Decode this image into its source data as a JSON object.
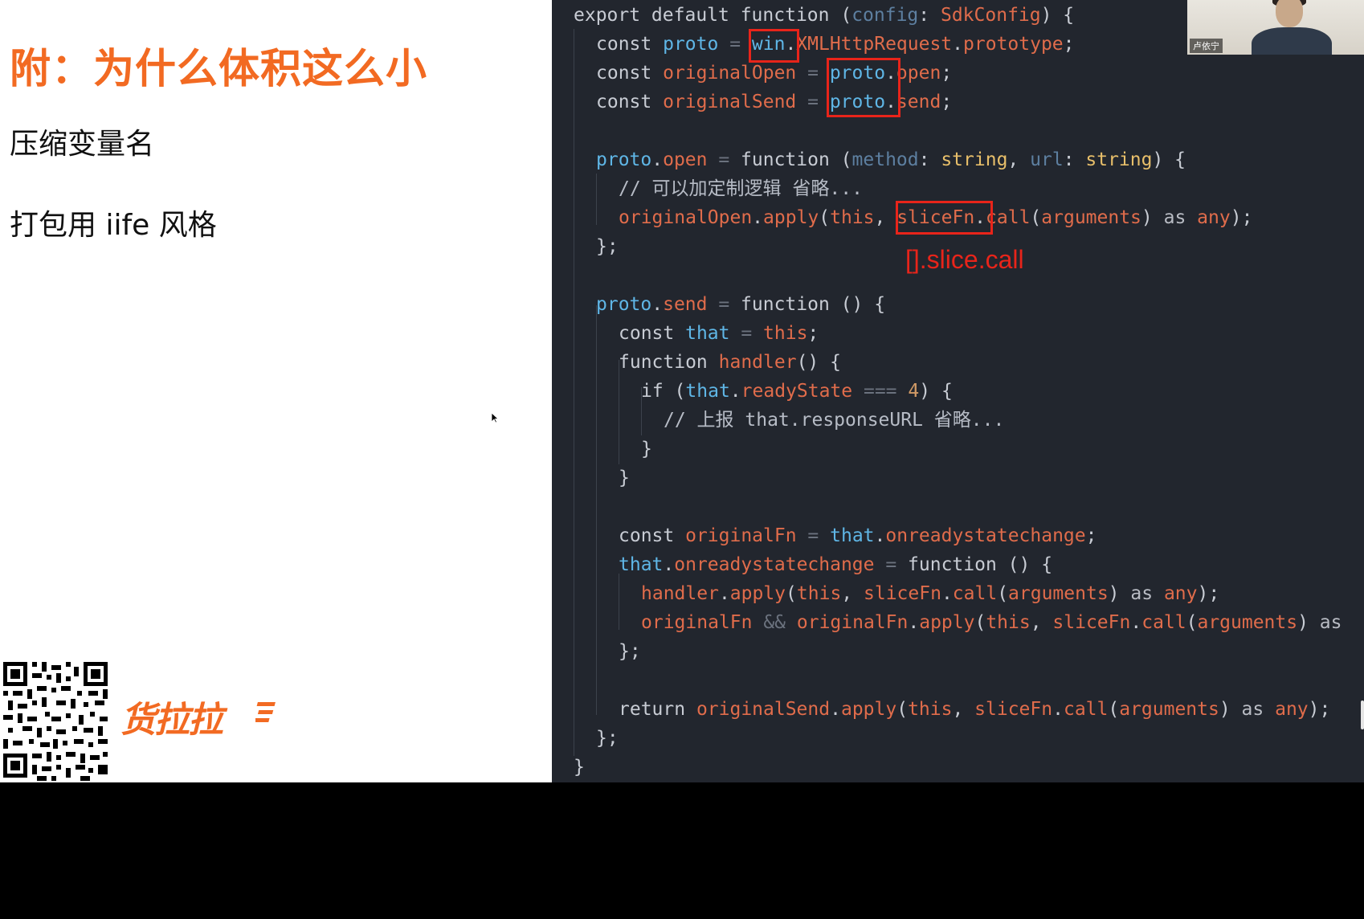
{
  "slide": {
    "title": "附：为什么体积这么小",
    "bullets": [
      "压缩变量名",
      "打包用 iife 风格"
    ],
    "logo_text": "货拉拉"
  },
  "webcam": {
    "name": "卢依宁"
  },
  "annotation": "[].slice.call",
  "code": {
    "l1": [
      "export default function (",
      "config",
      ": ",
      "SdkConfig",
      ") {"
    ],
    "l2": [
      "const ",
      "proto",
      " = ",
      "win",
      ".",
      "XMLHttpRequest",
      ".",
      "prototype",
      ";"
    ],
    "l3": [
      "const ",
      "originalOpen",
      " = ",
      "proto",
      ".",
      "open",
      ";"
    ],
    "l4": [
      "const ",
      "originalSend",
      " = ",
      "proto",
      ".",
      "send",
      ";"
    ],
    "l6": [
      "proto",
      ".",
      "open",
      " = ",
      "function",
      " (",
      "method",
      ": ",
      "string",
      ", ",
      "url",
      ": ",
      "string",
      ") {"
    ],
    "l7": "// 可以加定制逻辑 省略...",
    "l8": [
      "originalOpen",
      ".",
      "apply",
      "(",
      "this",
      ", ",
      "sliceFn",
      ".",
      "call",
      "(",
      "arguments",
      ") ",
      "as",
      " ",
      "any",
      ");"
    ],
    "l9": "};",
    "l11": [
      "proto",
      ".",
      "send",
      " = ",
      "function",
      " () {"
    ],
    "l12": [
      "const ",
      "that",
      " = ",
      "this",
      ";"
    ],
    "l13": [
      "function ",
      "handler",
      "() {"
    ],
    "l14": [
      "if ",
      "(",
      "that",
      ".",
      "readyState",
      " === ",
      "4",
      ") {"
    ],
    "l15": "// 上报 that.responseURL 省略...",
    "l16": "}",
    "l17": "}",
    "l19": [
      "const ",
      "originalFn",
      " = ",
      "that",
      ".",
      "onreadystatechange",
      ";"
    ],
    "l20": [
      "that",
      ".",
      "onreadystatechange",
      " = ",
      "function",
      " () {"
    ],
    "l21": [
      "handler",
      ".",
      "apply",
      "(",
      "this",
      ", ",
      "sliceFn",
      ".",
      "call",
      "(",
      "arguments",
      ") ",
      "as",
      " ",
      "any",
      ");"
    ],
    "l22": [
      "originalFn",
      " && ",
      "originalFn",
      ".",
      "apply",
      "(",
      "this",
      ", ",
      "sliceFn",
      ".",
      "call",
      "(",
      "arguments",
      ") ",
      "as"
    ],
    "l23": "};",
    "l25": [
      "return ",
      "originalSend",
      ".",
      "apply",
      "(",
      "this",
      ", ",
      "sliceFn",
      ".",
      "call",
      "(",
      "arguments",
      ") ",
      "as",
      " ",
      "any",
      ");"
    ],
    "l26": "};",
    "l27": "}"
  },
  "colors": {
    "accent": "#f26a22",
    "highlight": "#e8241a",
    "editor_bg": "#22262e"
  }
}
